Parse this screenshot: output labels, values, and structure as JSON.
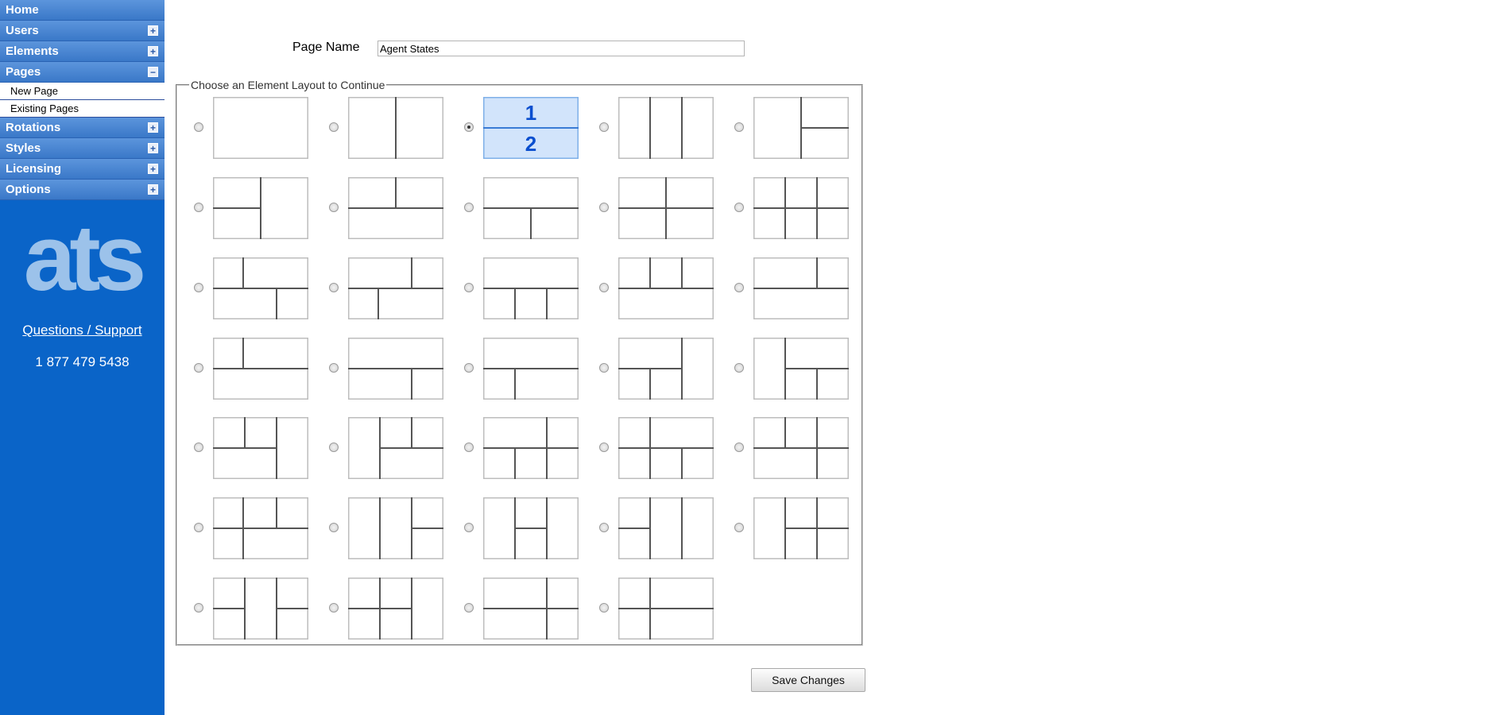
{
  "sidebar": {
    "items": [
      {
        "label": "Home",
        "toggle": ""
      },
      {
        "label": "Users",
        "toggle": "+"
      },
      {
        "label": "Elements",
        "toggle": "+"
      },
      {
        "label": "Pages",
        "toggle": "−"
      },
      {
        "label": "Rotations",
        "toggle": "+"
      },
      {
        "label": "Styles",
        "toggle": "+"
      },
      {
        "label": "Licensing",
        "toggle": "+"
      },
      {
        "label": "Options",
        "toggle": "+"
      }
    ],
    "subitems": [
      {
        "label": "New Page"
      },
      {
        "label": "Existing Pages"
      }
    ],
    "logo_text": "ats",
    "support_link": "Questions / Support",
    "phone": "1 877 479 5438"
  },
  "form": {
    "page_name_label": "Page Name",
    "page_name_value": "Agent States",
    "fieldset_legend": "Choose an Element Layout to Continue",
    "selected_layout_index": 2,
    "selected_numbers": [
      "1",
      "2"
    ],
    "save_label": "Save Changes"
  },
  "colors": {
    "sidebar_bg": "#0a64c8",
    "nav_gradient_top": "#5c95dc",
    "selected_thumb_bg": "#d2e4fb",
    "selected_number": "#0b4fcf"
  }
}
